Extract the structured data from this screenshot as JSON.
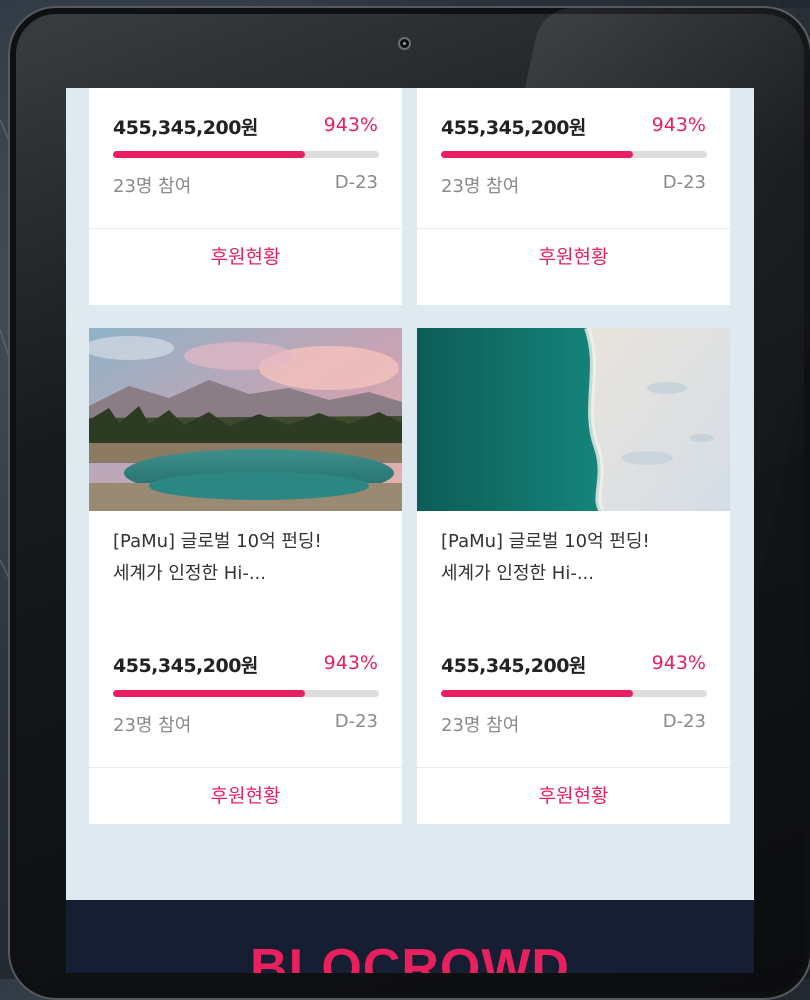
{
  "device": {
    "type": "tablet"
  },
  "cards": [
    {
      "title_line1": "",
      "title_line2": "",
      "amount": "455,345,200원",
      "percent": "943%",
      "progress": 0.72,
      "participants": "23명 참여",
      "dday": "D-23",
      "button": "후원현황",
      "image": "none"
    },
    {
      "title_line1": "",
      "title_line2": "",
      "amount": "455,345,200원",
      "percent": "943%",
      "progress": 0.72,
      "participants": "23명 참여",
      "dday": "D-23",
      "button": "후원현황",
      "image": "none"
    },
    {
      "title_line1": "[PaMu] 글로벌 10억 펀딩!",
      "title_line2": "세계가 인정한 Hi-...",
      "amount": "455,345,200원",
      "percent": "943%",
      "progress": 0.72,
      "participants": "23명 참여",
      "dday": "D-23",
      "button": "후원현황",
      "image": "mountain-lake-photo"
    },
    {
      "title_line1": "[PaMu] 글로벌 10억 펀딩!",
      "title_line2": "세계가 인정한 Hi-...",
      "amount": "455,345,200원",
      "percent": "943%",
      "progress": 0.72,
      "participants": "23명 참여",
      "dday": "D-23",
      "button": "후원현황",
      "image": "aerial-beach-photo"
    }
  ],
  "footer": {
    "logo_text": "BLOCROWD"
  },
  "colors": {
    "accent": "#e8215e",
    "screen_bg": "#dfeaf0",
    "footer_bg": "#161e33"
  }
}
